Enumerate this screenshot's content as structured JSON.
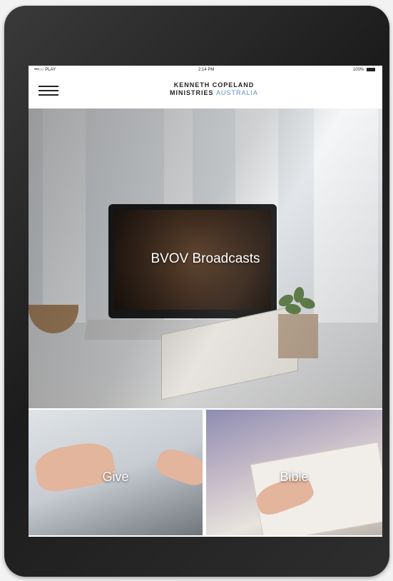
{
  "status_bar": {
    "carrier": "•••○○ PLAY",
    "time": "2:14 PM",
    "battery": "100%"
  },
  "header": {
    "logo_line1": "KENNETH COPELAND",
    "logo_line2": "MINISTRIES",
    "logo_accent": "AUSTRALIA",
    "menu_icon": "hamburger-menu-icon"
  },
  "hero": {
    "label": "BVOV Broadcasts"
  },
  "tiles": [
    {
      "label": "Give"
    },
    {
      "label": "Bible"
    }
  ],
  "colors": {
    "accent": "#5b8fc7",
    "text_dark": "#222222",
    "bezel": "#222222"
  }
}
